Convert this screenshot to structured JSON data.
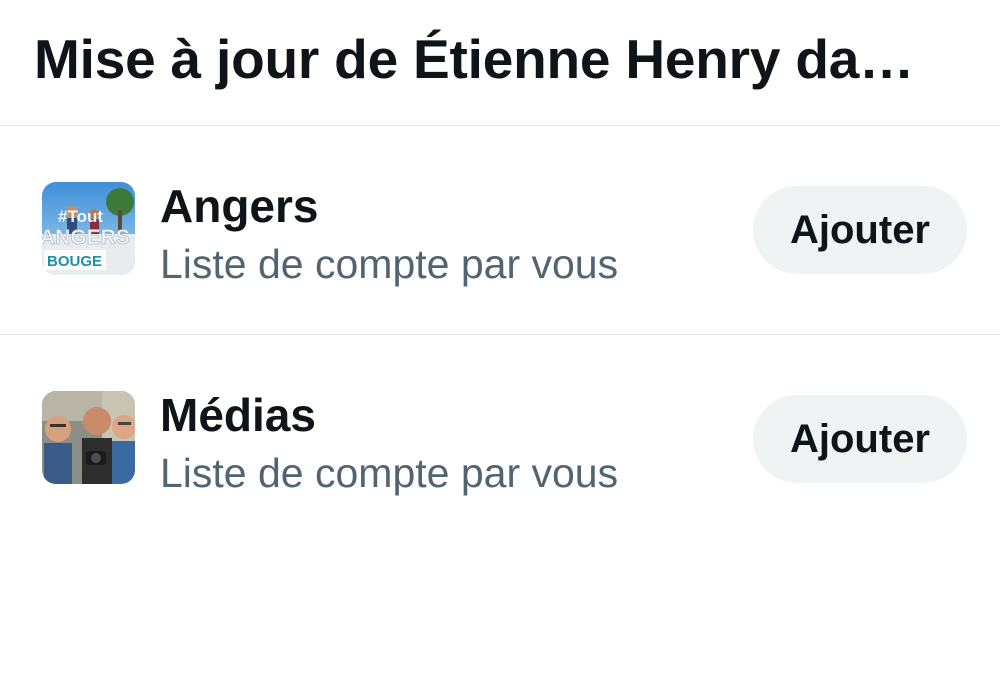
{
  "header": {
    "title": "Mise à jour de Étienne Henry da…"
  },
  "lists": [
    {
      "name": "Angers",
      "subtitle": "Liste de compte par vous",
      "button_label": "Ajouter",
      "thumbnail": {
        "text_top": "#Tout",
        "text_mid": "ANGERS",
        "text_bottom": "BOUGE"
      }
    },
    {
      "name": "Médias",
      "subtitle": "Liste de compte par vous",
      "button_label": "Ajouter"
    }
  ],
  "colors": {
    "title": "#0f1419",
    "subtitle": "#536471",
    "button_bg": "#eff3f4",
    "divider": "#e5e8eb"
  }
}
